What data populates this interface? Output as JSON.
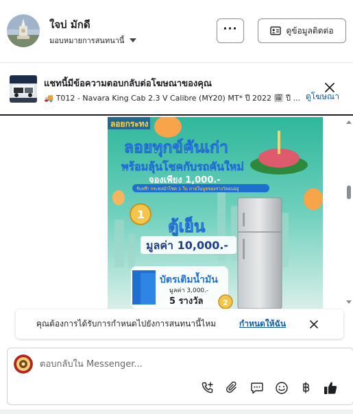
{
  "header": {
    "user_name": "ใจบ่ มักดี",
    "assign_label": "มอบหมายการสนทนานี้",
    "more_label": "···",
    "contact_info_label": "ดูข้อมูลติดต่อ"
  },
  "ad_reply": {
    "title": "แชทนี้มีข้อความตอบกลับต่อโฆษณาของคุณ",
    "subtitle": "T012 - Navara King Cab 2.3 V Calibre (MY20) MT* ปี 2022 🗓 ปี ...",
    "view_ad_label": "ดูโฆษณา"
  },
  "ad_image": {
    "line1": "ลอยทุกข์คันเก่า",
    "line2": "พร้อมลุ้นโชคกับรถคันใหม่",
    "line3": "จองเพียง 1,000.-",
    "line4": "รับฟรี! กระทงนำโชค 1 ใบ ภายในบูธของรางวัลอบอยู่",
    "prize_number": "1",
    "prize_name": "ตู้เย็น",
    "prize_value": "มูลค่า 10,000.-",
    "prize2_title": "บัตรเติมน้ำมัน",
    "prize2_value": "มูลค่า 3,000.-",
    "prize2_count": "5 รางวัล",
    "prize2_number": "2",
    "top_label": "ลอยกระทง"
  },
  "assign_prompt": {
    "text": "คุณต้องการได้รับการกำหนดไปยังการสนทนานี้ไหม",
    "link_label": "กำหนดให้ฉัน"
  },
  "composer": {
    "placeholder": "ตอบกลับใน Messenger..."
  },
  "colors": {
    "link": "#0b5cad",
    "ad_teal": "#3fb6a0",
    "ad_blue": "#1f6fd1"
  }
}
